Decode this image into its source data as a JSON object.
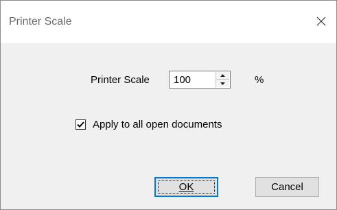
{
  "window": {
    "title": "Printer Scale"
  },
  "form": {
    "scale_label": "Printer Scale",
    "scale_value": "100",
    "unit": "%",
    "apply_all_label": "Apply to all open documents",
    "apply_all_checked": true
  },
  "buttons": {
    "ok_label": "OK",
    "cancel_label": "Cancel"
  },
  "icons": {
    "close": "close-icon",
    "spin_up": "arrow-up-icon",
    "spin_down": "arrow-down-icon",
    "check": "checkmark-icon"
  },
  "colors": {
    "dialog_bg": "#f0f0f0",
    "titlebar_bg": "#ffffff",
    "default_button_border": "#0078d7"
  }
}
